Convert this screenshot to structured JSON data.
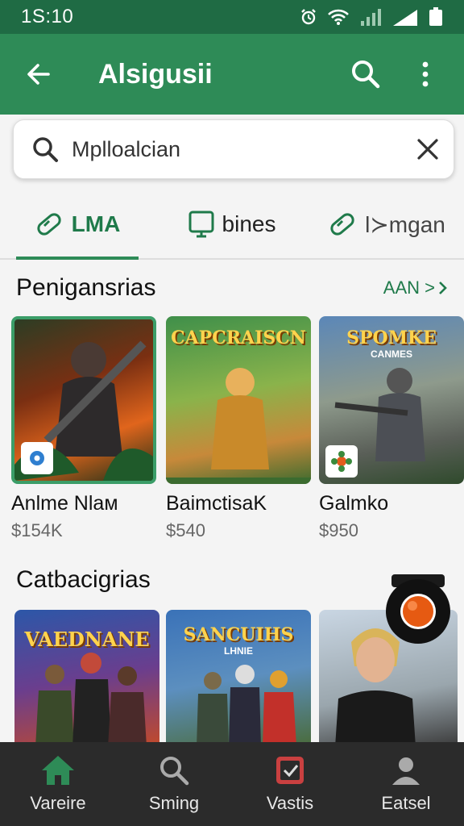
{
  "status_bar": {
    "time": "1S:10"
  },
  "app_bar": {
    "title": "Alsigusii",
    "back_icon": "back-arrow-icon",
    "search_icon": "search-icon",
    "more_icon": "more-vert-icon"
  },
  "search": {
    "value": "Mplloalcian"
  },
  "tabs": [
    {
      "label": "LMA",
      "active": true
    },
    {
      "label": "bines",
      "active": false
    },
    {
      "label": "Ɩ≻mgan",
      "active": false
    }
  ],
  "section1": {
    "title": "Penigansrias",
    "see_all": "AAN >",
    "items": [
      {
        "name": "Anlme Nlaм",
        "price": "$154K",
        "thumb_text": "",
        "thumb_sub": ""
      },
      {
        "name": "BaimctisaK",
        "price": "$540",
        "thumb_text": "CAPCRAISCN",
        "thumb_sub": ""
      },
      {
        "name": "Galmko",
        "price": "$950",
        "thumb_text": "SPOMKE",
        "thumb_sub": "CANMES"
      }
    ]
  },
  "section2": {
    "title": "Catbacigrias",
    "items": [
      {
        "thumb_text": "VAEDNANE",
        "thumb_sub": ""
      },
      {
        "thumb_text": "SANCUIHS",
        "thumb_sub": "LHNIE"
      },
      {
        "thumb_text": "",
        "thumb_sub": ""
      }
    ]
  },
  "bottom_nav": [
    {
      "label": "Vareire",
      "icon": "home-icon"
    },
    {
      "label": "Sming",
      "icon": "search-icon"
    },
    {
      "label": "Vastis",
      "icon": "checkbox-icon"
    },
    {
      "label": "Eatsel",
      "icon": "profile-icon"
    }
  ],
  "colors": {
    "primary": "#2e8b57",
    "primary_dark": "#1f6b44",
    "nav_bg": "#2b2b2b",
    "fab": "#e65a12"
  }
}
